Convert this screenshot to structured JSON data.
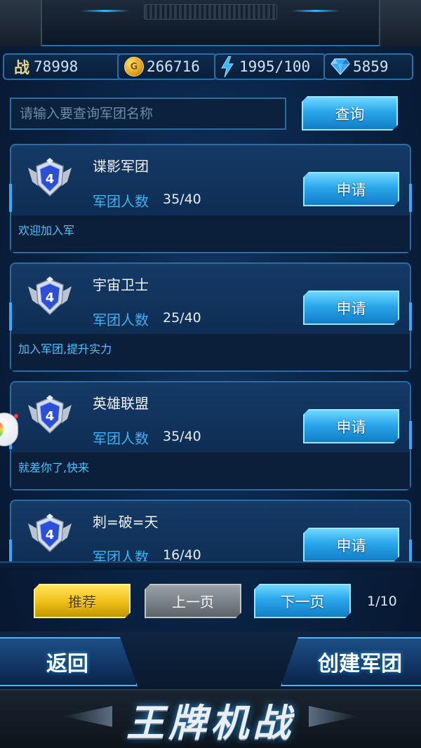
{
  "resources": {
    "battle_icon": "战",
    "battle": "78998",
    "gold": "266716",
    "energy": "1995/100",
    "gems": "5859"
  },
  "search": {
    "placeholder": "请输入要查询军团名称",
    "button": "查询"
  },
  "guilds": [
    {
      "name": "谍影军团",
      "member_label": "军团人数",
      "members": "35/40",
      "desc": "欢迎加入军",
      "apply": "申请",
      "level": "4"
    },
    {
      "name": "宇宙卫士",
      "member_label": "军团人数",
      "members": "25/40",
      "desc": "加入军团,提升实力",
      "apply": "申请",
      "level": "4"
    },
    {
      "name": "英雄联盟",
      "member_label": "军团人数",
      "members": "35/40",
      "desc": "就差你了,快来",
      "apply": "申请",
      "level": "4"
    },
    {
      "name": "刺=破=天",
      "member_label": "军团人数",
      "members": "16/40",
      "desc": "",
      "apply": "申请",
      "level": "4"
    }
  ],
  "pagination": {
    "recommend": "推荐",
    "prev": "上一页",
    "next": "下一页",
    "page": "1/10"
  },
  "footer": {
    "back": "返回",
    "create": "创建军团",
    "logo": "王牌机战"
  },
  "colors": {
    "accent_blue": "#2aa6ea",
    "member_label": "#3bb3f2",
    "recommend_yellow": "#f0c31a",
    "background": "#0a2446"
  }
}
